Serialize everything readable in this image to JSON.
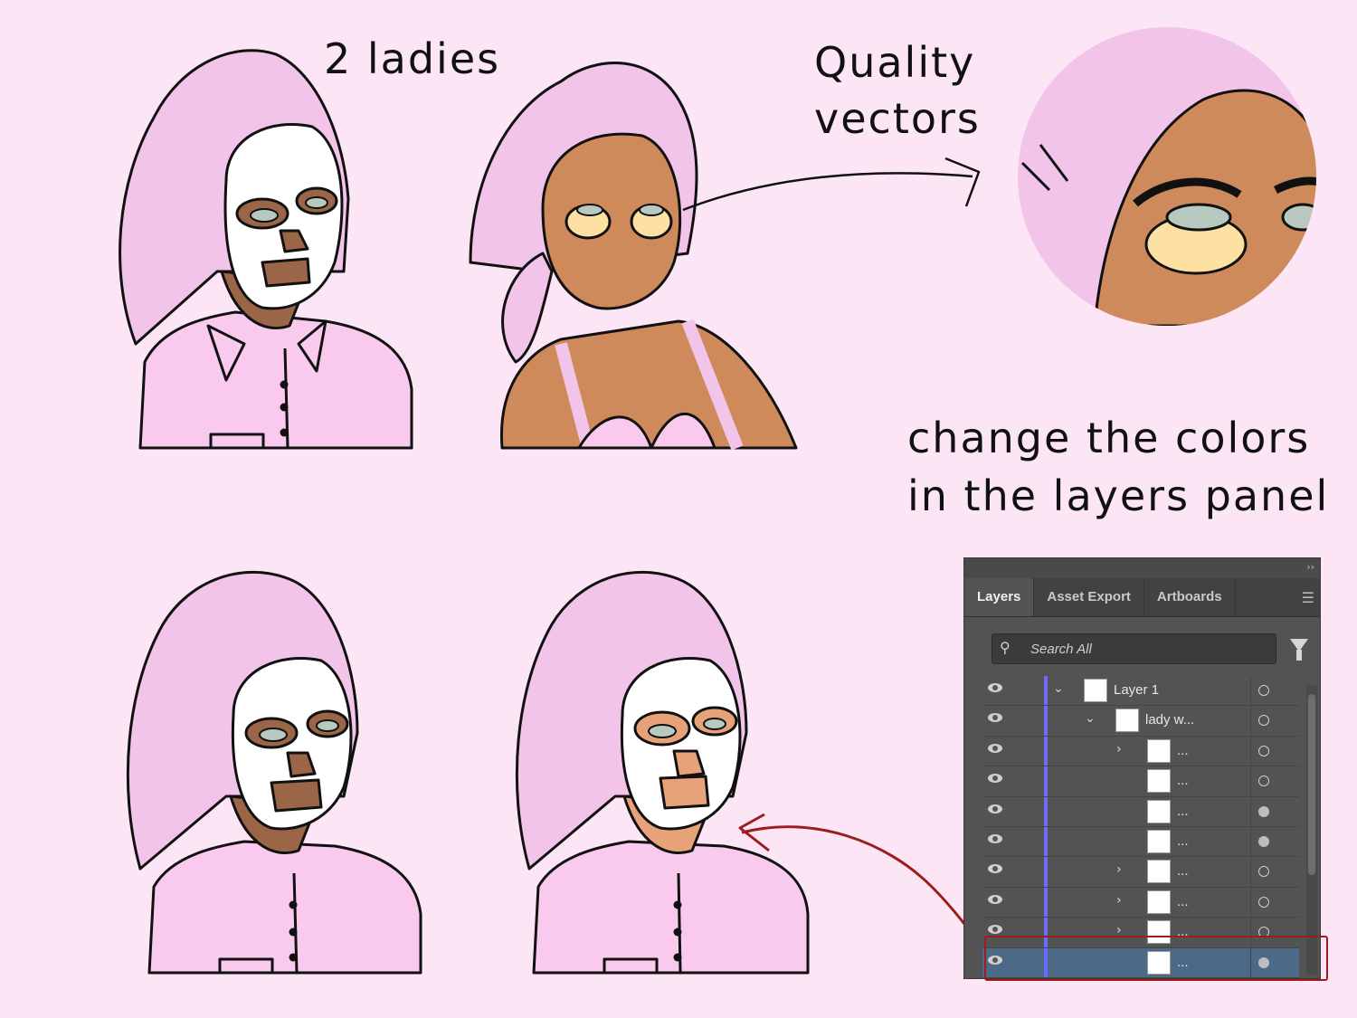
{
  "texts": {
    "ladies": "2 ladies",
    "quality_line1": "Quality",
    "quality_line2": "vectors",
    "change_line1": "change the colors",
    "change_line2": "in the layers panel"
  },
  "colors": {
    "background": "#fce6f5",
    "towel": "#f3c4ea",
    "skin_dark": "#9b6547",
    "skin_medium": "#cf8a5c",
    "skin_light": "#e8a27a",
    "mask": "#ffffff",
    "eye_patch": "#fde1a2",
    "shirt": "#f9c9ee",
    "arrow_red": "#9b1d1d"
  },
  "layers_panel": {
    "tabs": [
      "Layers",
      "Asset Export",
      "Artboards"
    ],
    "active_tab": "Layers",
    "search_placeholder": "Search All",
    "rows": [
      {
        "label": "Layer 1",
        "depth": 0,
        "expanded": true,
        "target": "hollow"
      },
      {
        "label": "lady w...",
        "depth": 1,
        "expanded": true,
        "target": "hollow"
      },
      {
        "label": "...",
        "depth": 2,
        "expand": true,
        "target": "hollow"
      },
      {
        "label": "...",
        "depth": 2,
        "expand": false,
        "target": "hollow"
      },
      {
        "label": "...",
        "depth": 2,
        "expand": false,
        "target": "filled"
      },
      {
        "label": "...",
        "depth": 2,
        "expand": false,
        "target": "filled"
      },
      {
        "label": "...",
        "depth": 2,
        "expand": true,
        "target": "hollow"
      },
      {
        "label": "...",
        "depth": 2,
        "expand": true,
        "target": "hollow"
      },
      {
        "label": "...",
        "depth": 2,
        "expand": true,
        "target": "hollow"
      },
      {
        "label": "...",
        "depth": 2,
        "expand": false,
        "target": "filled",
        "selected": true
      }
    ]
  },
  "icons": [
    "eye-icon",
    "search-icon",
    "filter-icon",
    "menu-icon",
    "chevron-icon",
    "collapse-icon"
  ]
}
